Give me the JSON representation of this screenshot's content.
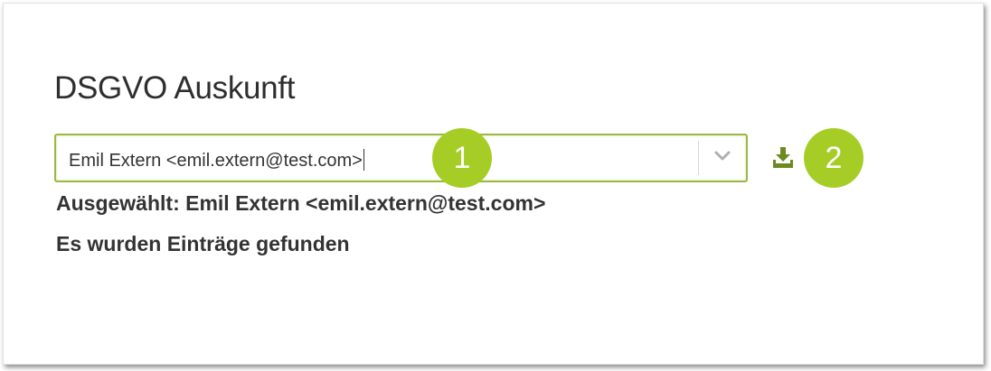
{
  "page": {
    "title": "DSGVO Auskunft"
  },
  "select": {
    "value": "Emil Extern <emil.extern@test.com>",
    "toggle_icon": "chevron-down-icon"
  },
  "download": {
    "icon": "download-icon",
    "color": "#6b8a1f"
  },
  "badges": [
    {
      "label": "1"
    },
    {
      "label": "2"
    }
  ],
  "info": {
    "selected": "Ausgewählt: Emil Extern <emil.extern@test.com>",
    "found": "Es wurden Einträge gefunden"
  },
  "colors": {
    "accent": "#a6cd26",
    "focus_border": "#9cb844",
    "text": "#333333"
  }
}
